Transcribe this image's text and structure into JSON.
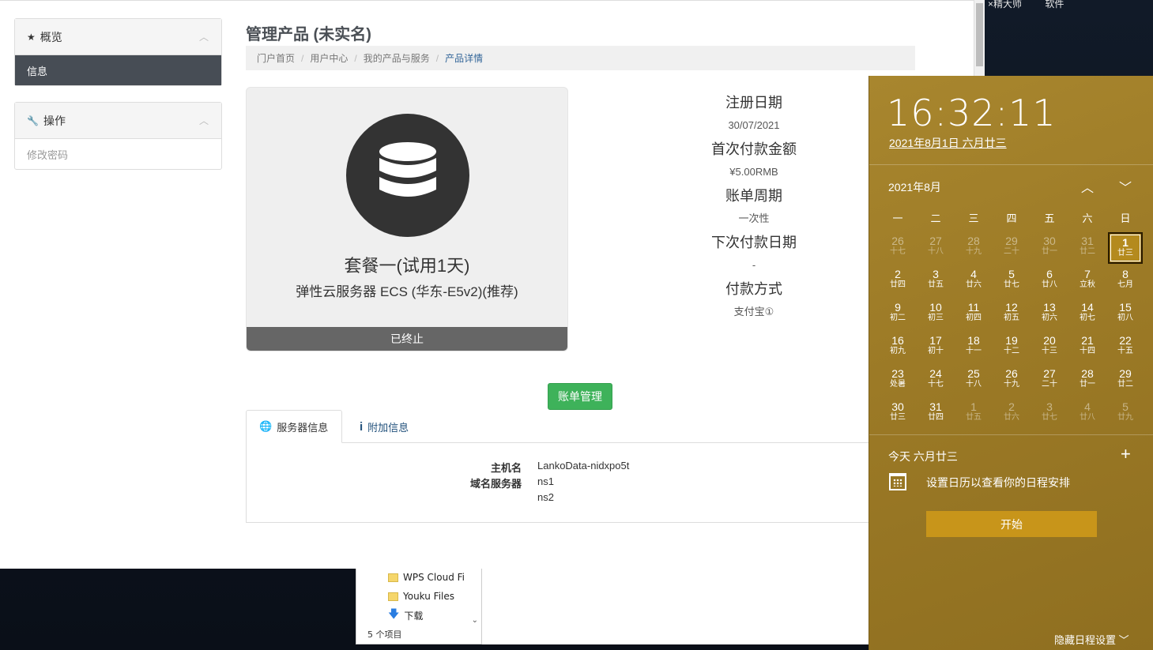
{
  "desktop": {
    "labels": [
      "×精大师",
      "软件"
    ]
  },
  "explorer": {
    "items": [
      "WPS Cloud Fi",
      "Youku Files",
      "下载"
    ],
    "status": "5 个项目"
  },
  "sidebar": {
    "overview": {
      "title": "概览",
      "items": [
        "信息"
      ]
    },
    "actions": {
      "title": "操作",
      "items": [
        "修改密码"
      ]
    }
  },
  "header": {
    "title": "管理产品 (未实名)",
    "breadcrumb": [
      "门户首页",
      "用户中心",
      "我的产品与服务",
      "产品详情"
    ]
  },
  "product": {
    "name": "套餐一(试用1天)",
    "subtitle": "弹性云服务器 ECS (华东-E5v2)(推荐)",
    "status": "已终止",
    "icon": "database-icon"
  },
  "info": {
    "reg_date_label": "注册日期",
    "reg_date": "30/07/2021",
    "first_pay_label": "首次付款金额",
    "first_pay": "¥5.00RMB",
    "cycle_label": "账单周期",
    "cycle": "一次性",
    "next_due_label": "下次付款日期",
    "next_due": "-",
    "method_label": "付款方式",
    "method": "支付宝①"
  },
  "bill_button": "账单管理",
  "tabs": {
    "server_info": "服务器信息",
    "extra_info": "附加信息"
  },
  "server": {
    "hostname_label": "主机名",
    "hostname": "LankoData-nidxpo5t",
    "ns_label": "域名服务器",
    "ns1": "ns1",
    "ns2": "ns2"
  },
  "calendar": {
    "time": "16:32:11",
    "date_full": "2021年8月1日 六月廿三",
    "month_label": "2021年8月",
    "weekdays": [
      "一",
      "二",
      "三",
      "四",
      "五",
      "六",
      "日"
    ],
    "days": [
      {
        "n": "26",
        "l": "十七",
        "dim": true
      },
      {
        "n": "27",
        "l": "十八",
        "dim": true
      },
      {
        "n": "28",
        "l": "十九",
        "dim": true
      },
      {
        "n": "29",
        "l": "二十",
        "dim": true
      },
      {
        "n": "30",
        "l": "廿一",
        "dim": true
      },
      {
        "n": "31",
        "l": "廿二",
        "dim": true
      },
      {
        "n": "1",
        "l": "廿三",
        "today": true
      },
      {
        "n": "2",
        "l": "廿四"
      },
      {
        "n": "3",
        "l": "廿五"
      },
      {
        "n": "4",
        "l": "廿六"
      },
      {
        "n": "5",
        "l": "廿七"
      },
      {
        "n": "6",
        "l": "廿八"
      },
      {
        "n": "7",
        "l": "立秋"
      },
      {
        "n": "8",
        "l": "七月"
      },
      {
        "n": "9",
        "l": "初二"
      },
      {
        "n": "10",
        "l": "初三"
      },
      {
        "n": "11",
        "l": "初四"
      },
      {
        "n": "12",
        "l": "初五"
      },
      {
        "n": "13",
        "l": "初六"
      },
      {
        "n": "14",
        "l": "初七"
      },
      {
        "n": "15",
        "l": "初八"
      },
      {
        "n": "16",
        "l": "初九"
      },
      {
        "n": "17",
        "l": "初十"
      },
      {
        "n": "18",
        "l": "十一"
      },
      {
        "n": "19",
        "l": "十二"
      },
      {
        "n": "20",
        "l": "十三"
      },
      {
        "n": "21",
        "l": "十四"
      },
      {
        "n": "22",
        "l": "十五"
      },
      {
        "n": "23",
        "l": "处暑"
      },
      {
        "n": "24",
        "l": "十七"
      },
      {
        "n": "25",
        "l": "十八"
      },
      {
        "n": "26",
        "l": "十九"
      },
      {
        "n": "27",
        "l": "二十"
      },
      {
        "n": "28",
        "l": "廿一"
      },
      {
        "n": "29",
        "l": "廿二"
      },
      {
        "n": "30",
        "l": "廿三"
      },
      {
        "n": "31",
        "l": "廿四"
      },
      {
        "n": "1",
        "l": "廿五",
        "dim": true
      },
      {
        "n": "2",
        "l": "廿六",
        "dim": true
      },
      {
        "n": "3",
        "l": "廿七",
        "dim": true
      },
      {
        "n": "4",
        "l": "廿八",
        "dim": true
      },
      {
        "n": "5",
        "l": "廿九",
        "dim": true
      }
    ],
    "today_label": "今天 六月廿三",
    "agenda_msg": "设置日历以查看你的日程安排",
    "start_button": "开始",
    "hide_link": "隐藏日程设置"
  }
}
